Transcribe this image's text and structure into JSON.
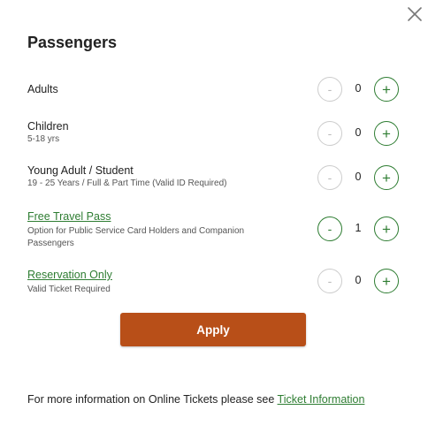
{
  "dialog": {
    "title": "Passengers",
    "close_icon": "close-icon",
    "apply_label": "Apply",
    "accent_color": "#2e7d32",
    "apply_color": "#b84f18"
  },
  "passengers": [
    {
      "label": "Adults",
      "sub": "",
      "count": "0",
      "is_link": false,
      "minus": "-",
      "plus": "+"
    },
    {
      "label": "Children",
      "sub": "5-18 yrs",
      "count": "0",
      "is_link": false,
      "minus": "-",
      "plus": "+"
    },
    {
      "label": "Young Adult / Student",
      "sub": "19 - 25 Years / Full & Part Time (Valid ID Required)",
      "count": "0",
      "is_link": false,
      "minus": "-",
      "plus": "+"
    },
    {
      "label": "Free Travel Pass",
      "sub": "Option for Public Service Card Holders and Companion Passengers",
      "count": "1",
      "is_link": true,
      "minus": "-",
      "plus": "+"
    },
    {
      "label": "Reservation Only",
      "sub": "Valid Ticket Required",
      "count": "0",
      "is_link": true,
      "minus": "-",
      "plus": "+"
    }
  ],
  "footer": {
    "text": "For more information on Online Tickets please see ",
    "link_label": "Ticket Information"
  }
}
